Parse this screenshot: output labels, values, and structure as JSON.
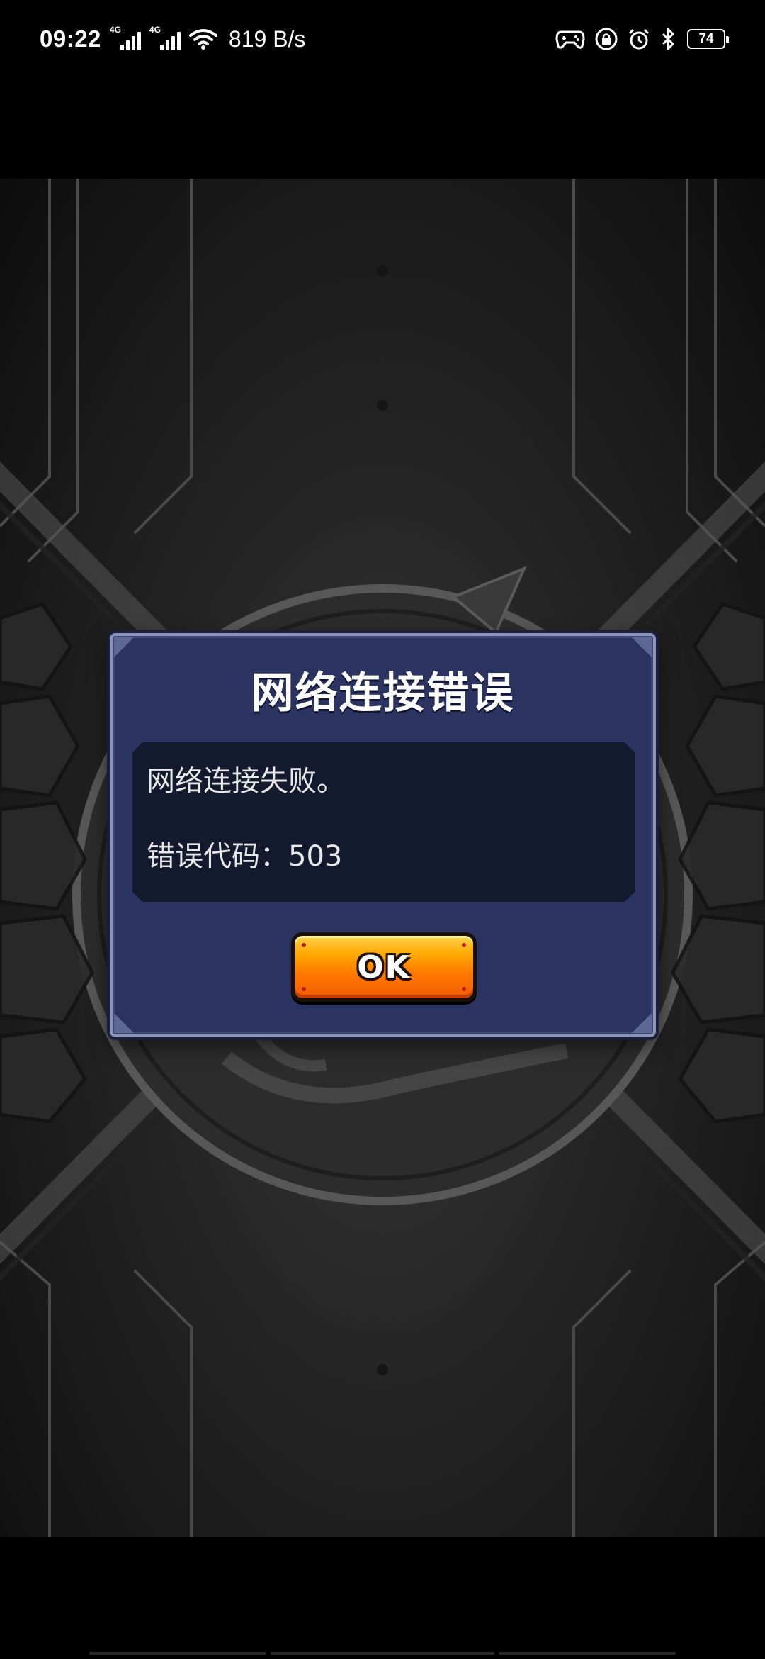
{
  "status_bar": {
    "time": "09:22",
    "signal_tag_1": "4G",
    "signal_tag_2": "4G",
    "net_speed": "819 B/s",
    "battery": "74",
    "icons": [
      "game-controller-icon",
      "lock-icon",
      "alarm-icon",
      "bluetooth-icon"
    ]
  },
  "dialog": {
    "title": "网络连接错误",
    "message": "网络连接失败。",
    "error_code": "错误代码：503",
    "ok_label": "OK"
  },
  "colors": {
    "dialog_bg": "#2b3460",
    "message_bg": "#141a2e",
    "button_orange": "#ff7a00"
  }
}
